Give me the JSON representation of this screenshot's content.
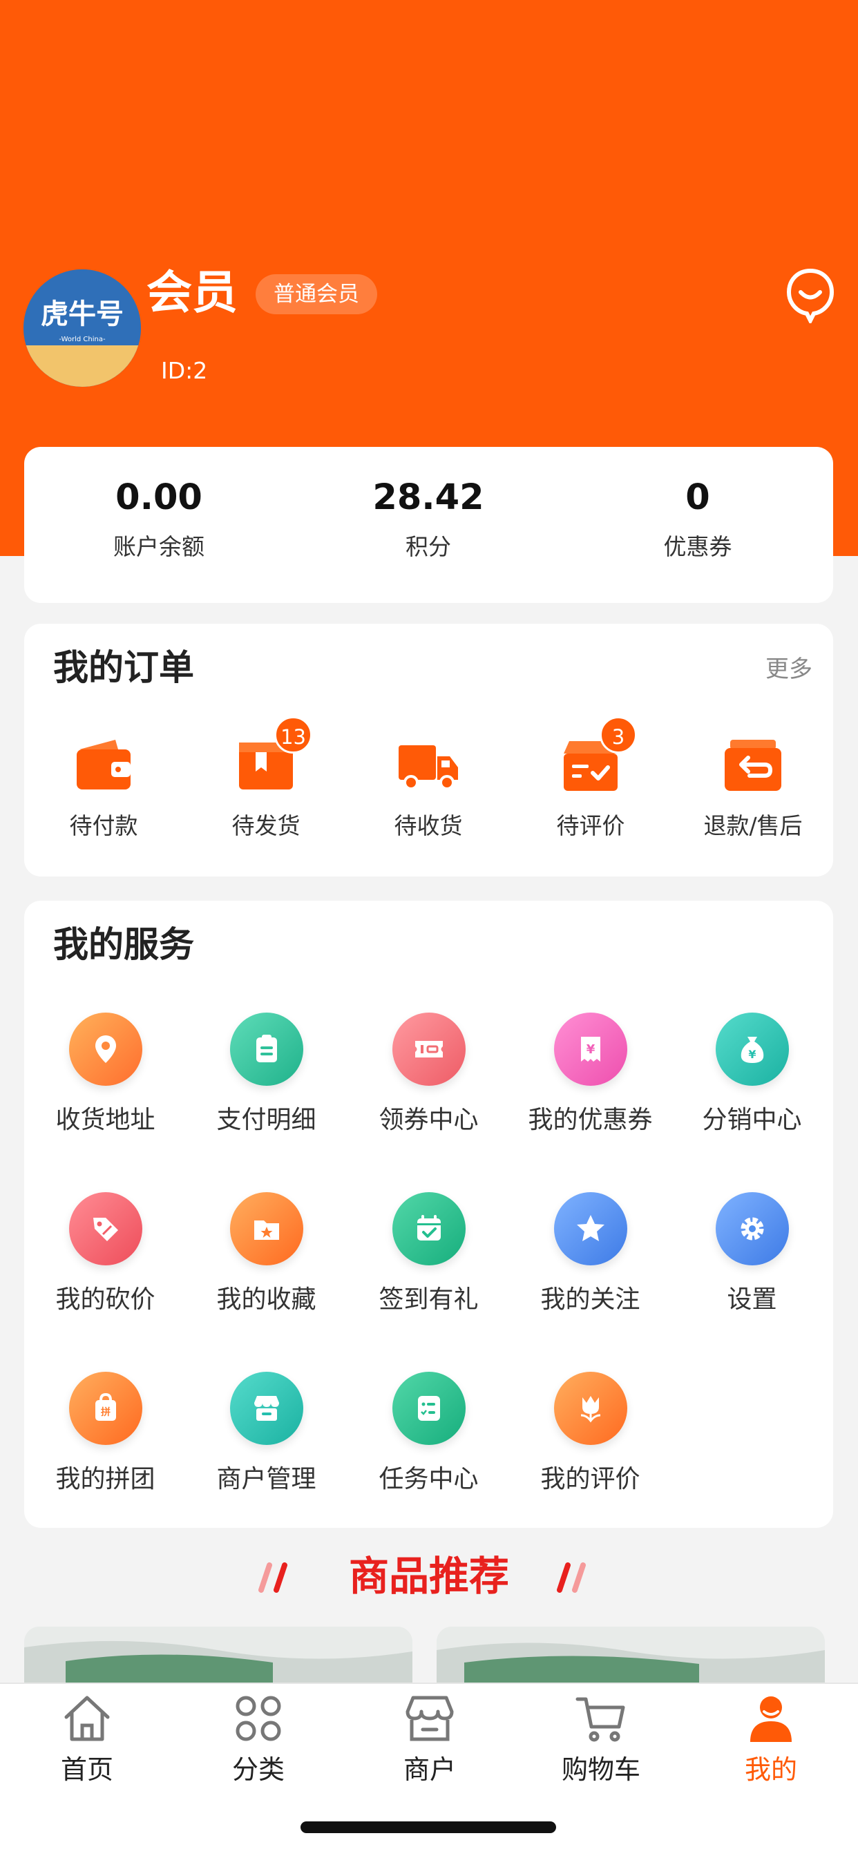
{
  "theme": {
    "accent": "#FF5A07",
    "recommend_red": "#E8211E"
  },
  "profile": {
    "name": "会员",
    "level_badge": "普通会员",
    "id_text": "ID:2",
    "avatar_text": "虎牛号",
    "avatar_subtext": "-World China-"
  },
  "stats": [
    {
      "value": "0.00",
      "label": "账户余额"
    },
    {
      "value": "28.42",
      "label": "积分"
    },
    {
      "value": "0",
      "label": "优惠券"
    }
  ],
  "orders": {
    "title": "我的订单",
    "more": "更多",
    "items": [
      {
        "label": "待付款",
        "icon": "wallet-icon",
        "badge": ""
      },
      {
        "label": "待发货",
        "icon": "package-icon",
        "badge": "13"
      },
      {
        "label": "待收货",
        "icon": "truck-icon",
        "badge": ""
      },
      {
        "label": "待评价",
        "icon": "review-box-icon",
        "badge": "3"
      },
      {
        "label": "退款/售后",
        "icon": "refund-icon",
        "badge": ""
      }
    ]
  },
  "services": {
    "title": "我的服务",
    "items": [
      {
        "label": "收货地址",
        "icon": "location-icon",
        "color": "#FF8A3D"
      },
      {
        "label": "支付明细",
        "icon": "clipboard-icon",
        "color": "#2FC19A"
      },
      {
        "label": "领券中心",
        "icon": "ticket-icon",
        "color": "#F26D73"
      },
      {
        "label": "我的优惠券",
        "icon": "coupon-icon",
        "color": "#F25FB8"
      },
      {
        "label": "分销中心",
        "icon": "money-bag-icon",
        "color": "#25BFAE"
      },
      {
        "label": "我的砍价",
        "icon": "tag-icon",
        "color": "#F25D67"
      },
      {
        "label": "我的收藏",
        "icon": "star-folder-icon",
        "color": "#FF7D2E"
      },
      {
        "label": "签到有礼",
        "icon": "calendar-check-icon",
        "color": "#24BF8F"
      },
      {
        "label": "我的关注",
        "icon": "star-icon",
        "color": "#4E8EF0"
      },
      {
        "label": "设置",
        "icon": "gear-icon",
        "color": "#4E8EF0"
      },
      {
        "label": "我的拼团",
        "icon": "group-bag-icon",
        "color": "#FF7D2E"
      },
      {
        "label": "商户管理",
        "icon": "shop-icon",
        "color": "#25BFAE"
      },
      {
        "label": "任务中心",
        "icon": "task-list-icon",
        "color": "#24BF8F"
      },
      {
        "label": "我的评价",
        "icon": "tulip-icon",
        "color": "#FF7D2E"
      }
    ]
  },
  "recommend": {
    "title": "商品推荐"
  },
  "tabbar": {
    "active": "我的",
    "items": [
      {
        "label": "首页",
        "icon": "home-icon"
      },
      {
        "label": "分类",
        "icon": "category-icon"
      },
      {
        "label": "商户",
        "icon": "store-icon"
      },
      {
        "label": "购物车",
        "icon": "cart-icon"
      },
      {
        "label": "我的",
        "icon": "user-icon"
      }
    ]
  }
}
